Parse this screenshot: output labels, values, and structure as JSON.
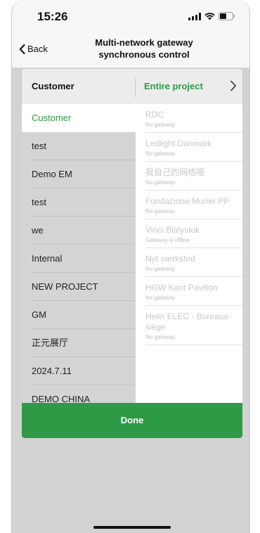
{
  "status_bar": {
    "time": "15:26"
  },
  "nav": {
    "back_label": "Back",
    "title_line1": "Multi-network gateway",
    "title_line2": "synchronous control"
  },
  "picker": {
    "left_header": "Customer",
    "right_header": "Entire project",
    "done_label": "Done",
    "customers": [
      {
        "label": "Customer",
        "selected": true
      },
      {
        "label": "test"
      },
      {
        "label": "Demo EM"
      },
      {
        "label": "test"
      },
      {
        "label": "we"
      },
      {
        "label": "Internal"
      },
      {
        "label": "NEW PROJECT"
      },
      {
        "label": "GM"
      },
      {
        "label": "正元展厅"
      },
      {
        "label": "2024.7.11"
      },
      {
        "label": "DEMO CHINA"
      }
    ],
    "projects": [
      {
        "name": "RDC",
        "status": "No gateway"
      },
      {
        "name": "Ledlight Danmark",
        "status": "No gateway"
      },
      {
        "name": "我自己的网络哦",
        "status": "No gateway"
      },
      {
        "name": "Fondazione Muner PP",
        "status": "No gateway"
      },
      {
        "name": "Vinci Bialystok",
        "status": "Gateway is offline"
      },
      {
        "name": "Nyt værksted",
        "status": "No gateway"
      },
      {
        "name": "HGW Kant Pavillon",
        "status": "No gateway"
      },
      {
        "name": "Helin ELEC - Bureaux siège",
        "status": "No gateway"
      }
    ]
  },
  "colors": {
    "accent": "#2e9a46"
  },
  "icons": [
    "signal-icon",
    "wifi-icon",
    "battery-icon",
    "chevron-left-icon",
    "chevron-right-icon"
  ]
}
